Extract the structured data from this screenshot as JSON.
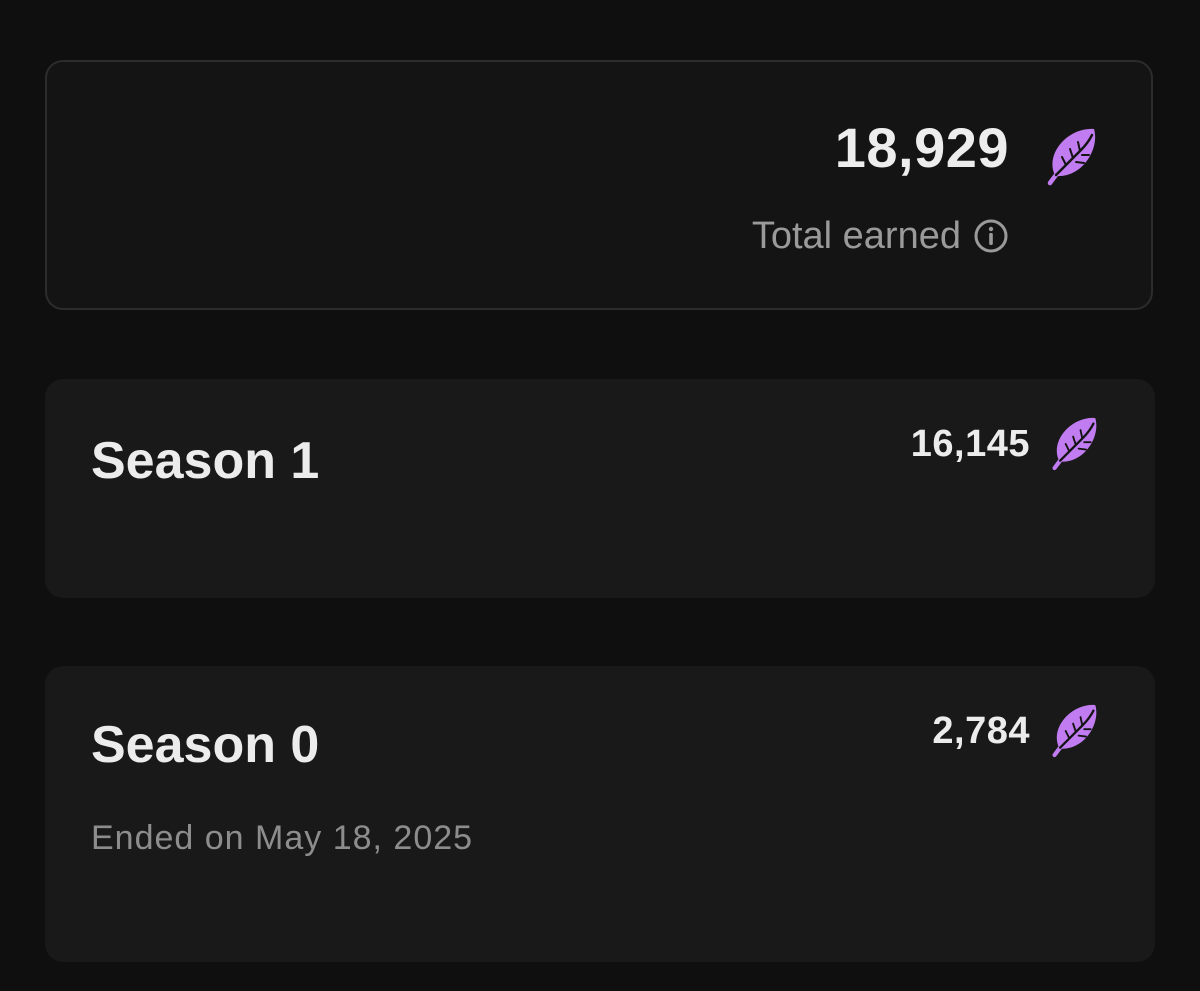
{
  "total": {
    "amount": "18,929",
    "label": "Total earned",
    "icons": {
      "currency": "feather-icon",
      "info": "info-icon"
    }
  },
  "seasons": [
    {
      "title": "Season 1",
      "amount": "16,145",
      "icon": "feather-icon"
    },
    {
      "title": "Season 0",
      "amount": "2,784",
      "ended": "Ended on May 18, 2025",
      "icon": "feather-icon"
    }
  ],
  "colors": {
    "background": "#0f0f0f",
    "card": "#191919",
    "card_border": "#2c2c2c",
    "accent_feather": "#c07cf0",
    "muted_text": "#9a9a9a"
  }
}
